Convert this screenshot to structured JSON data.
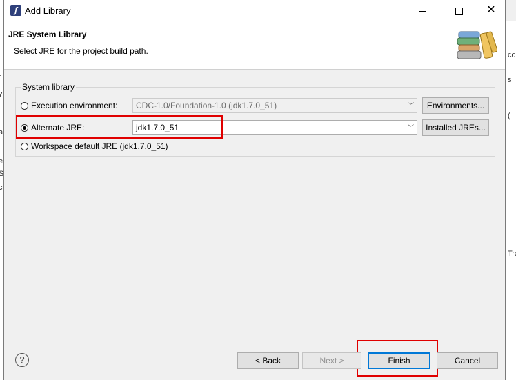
{
  "window": {
    "title": "Add Library",
    "app_icon": "eclipse-icon"
  },
  "header": {
    "title": "JRE System Library",
    "description": "Select JRE for the project build path.",
    "icon": "books-icon"
  },
  "group": {
    "legend": "System library",
    "options": [
      {
        "label": "Execution environment:",
        "selected": false,
        "combo_value": "CDC-1.0/Foundation-1.0 (jdk1.7.0_51)",
        "button": "Environments..."
      },
      {
        "label": "Alternate JRE:",
        "selected": true,
        "combo_value": "jdk1.7.0_51",
        "button": "Installed JREs..."
      },
      {
        "label": "Workspace default JRE (jdk1.7.0_51)",
        "selected": false
      }
    ]
  },
  "footer": {
    "help": "?",
    "back": "< Back",
    "next": "Next >",
    "finish": "Finish",
    "cancel": "Cancel"
  },
  "highlight_color": "#e00000",
  "background_fragments": {
    "left": [
      "t",
      "y",
      "at",
      "e",
      "Se",
      "c"
    ],
    "right": [
      "cc",
      "s",
      "(",
      "Tra"
    ]
  }
}
